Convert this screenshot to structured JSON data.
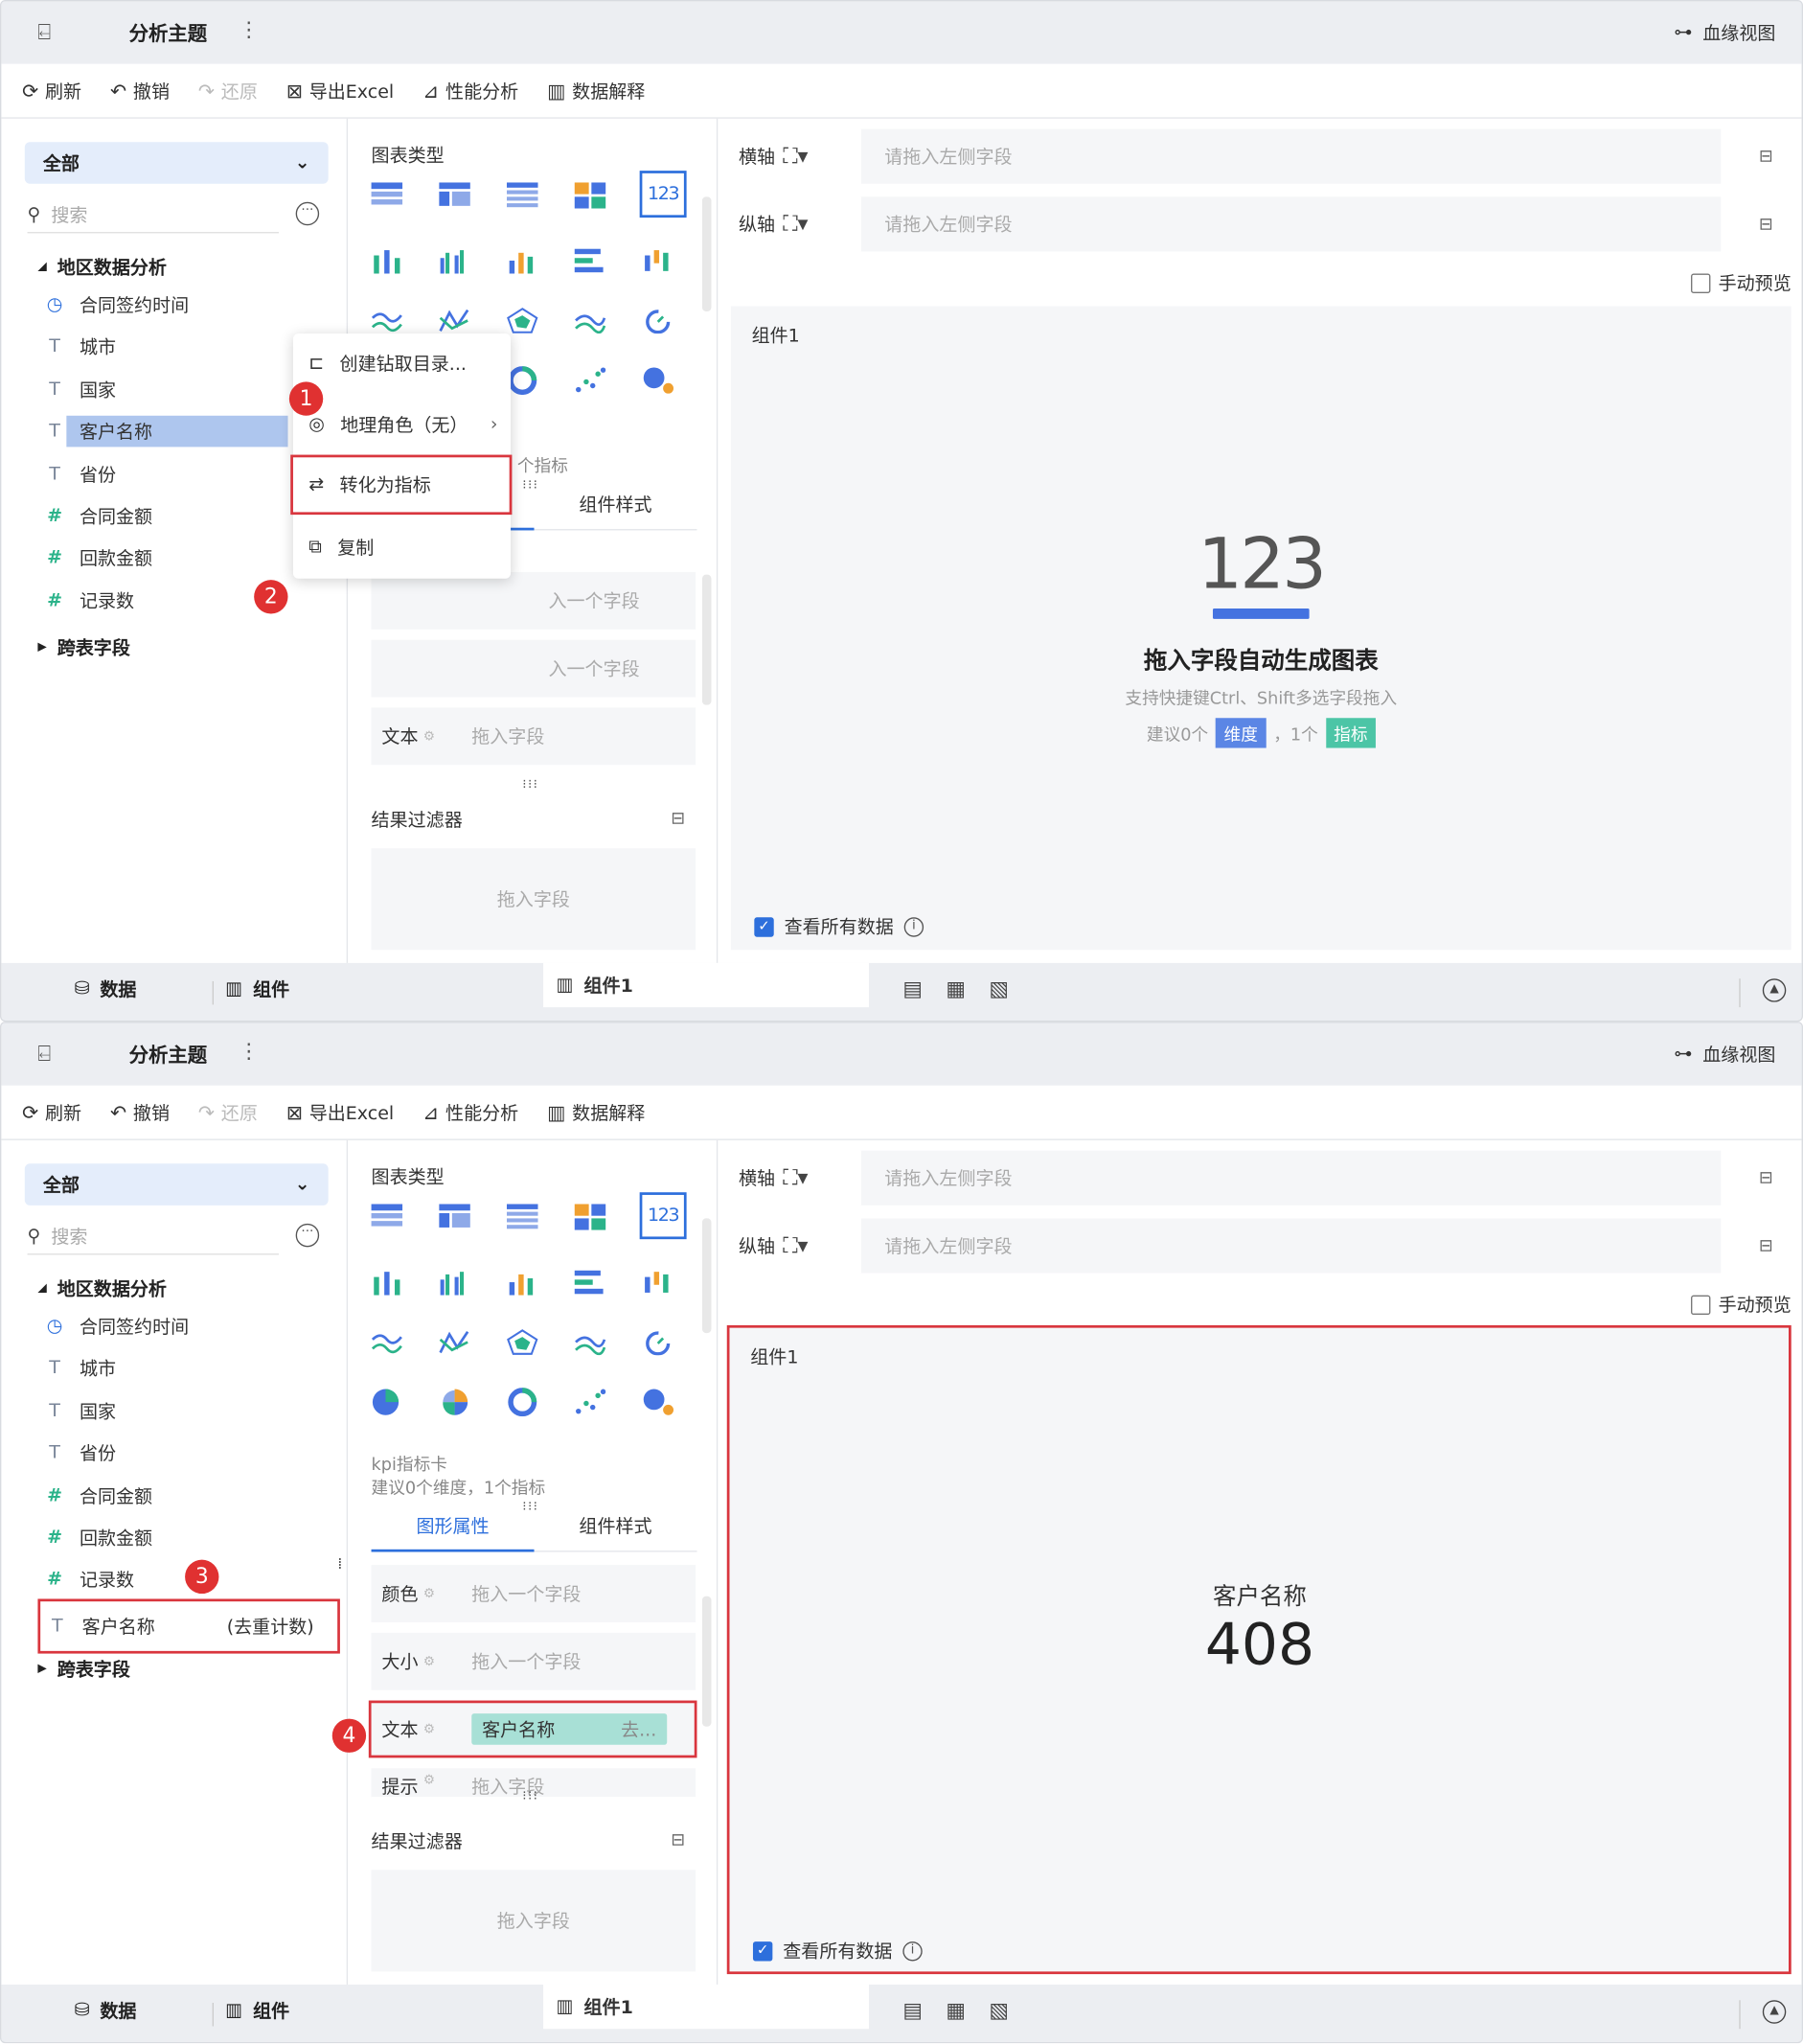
{
  "header": {
    "back_icon": "exit-icon",
    "title": "分析主题",
    "more": "⋮",
    "lineage": "血缘视图"
  },
  "toolbar": {
    "refresh": "刷新",
    "undo": "撤销",
    "redo": "还原",
    "export": "导出Excel",
    "perf": "性能分析",
    "explain": "数据解释"
  },
  "left": {
    "select_value": "全部",
    "search_placeholder": "搜索",
    "group": "地区数据分析",
    "fields_top": [
      {
        "type": "date",
        "label": "合同签约时间"
      },
      {
        "type": "text",
        "label": "城市"
      },
      {
        "type": "text",
        "label": "国家"
      },
      {
        "type": "text",
        "label": "客户名称"
      },
      {
        "type": "text",
        "label": "省份"
      },
      {
        "type": "number",
        "label": "合同金额"
      },
      {
        "type": "number",
        "label": "回款金额"
      },
      {
        "type": "count",
        "label": "记录数"
      }
    ],
    "fields_bottom": [
      {
        "type": "date",
        "label": "合同签约时间"
      },
      {
        "type": "text",
        "label": "城市"
      },
      {
        "type": "text",
        "label": "国家"
      },
      {
        "type": "text",
        "label": "省份"
      },
      {
        "type": "number",
        "label": "合同金额"
      },
      {
        "type": "number",
        "label": "回款金额"
      },
      {
        "type": "count",
        "label": "记录数"
      }
    ],
    "converted_field": {
      "label": "客户名称",
      "suffix": "(去重计数)"
    },
    "cross_group": "跨表字段"
  },
  "menu": {
    "items": [
      {
        "icon": "drill-tree-icon",
        "label": "创建钻取目录..."
      },
      {
        "icon": "globe-icon",
        "label": "地理角色（无）"
      },
      {
        "icon": "swap-icon",
        "label": "转化为指标"
      },
      {
        "icon": "copy-icon",
        "label": "复制"
      }
    ]
  },
  "badges": [
    "1",
    "2",
    "3",
    "4"
  ],
  "chart_panel": {
    "label": "图表类型",
    "selected_icon_text": "123",
    "kpi_title": "kpi指标卡",
    "kpi_hint": "建议0个维度，1个指标",
    "kpi_hint_partial": "个指标",
    "tab_graph": "图形属性",
    "tab_style": "组件样式",
    "slot_color": "颜色",
    "slot_size": "大小",
    "slot_text": "文本",
    "slot_tip": "提示",
    "drop_one": "拖入一个字段",
    "drop_one_partial": "入一个字段",
    "drop_field": "拖入字段",
    "pill_name": "客户名称",
    "pill_suffix": "去...",
    "result_filter": "结果过滤器"
  },
  "right": {
    "x_axis": "横轴",
    "y_axis": "纵轴",
    "axis_placeholder": "请拖入左侧字段",
    "manual_preview": "手动预览",
    "component_name": "组件1",
    "view_all": "查看所有数据",
    "empty_big": "123",
    "empty_title": "拖入字段自动生成图表",
    "empty_sub": "支持快捷键Ctrl、Shift多选字段拖入",
    "empty_hint_a": "建议0个",
    "empty_tag_dim": "维度",
    "empty_hint_b": "，1个",
    "empty_tag_mea": "指标",
    "kpi_name": "客户名称",
    "kpi_value": "408"
  },
  "bottom": {
    "data": "数据",
    "component": "组件",
    "tab": "组件1"
  }
}
